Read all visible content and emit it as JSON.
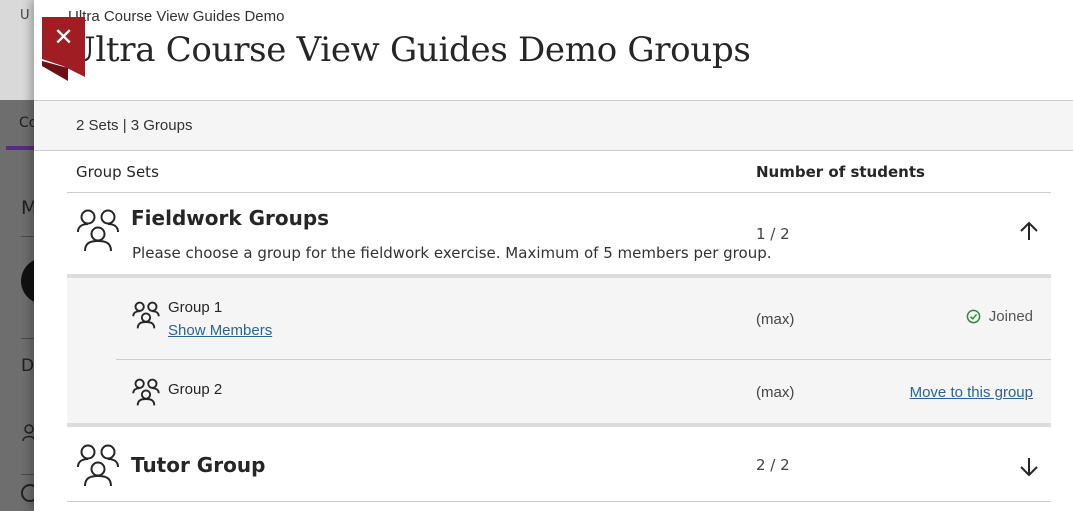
{
  "background": {
    "partial_letters": [
      "U",
      "Co",
      "M",
      "D"
    ]
  },
  "panel": {
    "close_label": "✕",
    "breadcrumb": "Ultra Course View Guides Demo",
    "title": "Ultra Course View Guides Demo Groups",
    "summary": "2 Sets | 3 Groups",
    "columns": {
      "group_sets": "Group Sets",
      "number_of_students": "Number of students"
    }
  },
  "group_sets": [
    {
      "name": "Fieldwork Groups",
      "description": "Please choose a group for the fieldwork exercise. Maximum of 5 members per group.",
      "count": "1 / 2",
      "expanded": true,
      "groups": [
        {
          "name": "Group 1",
          "show_members": "Show Members",
          "max": "(max)",
          "status": "Joined"
        },
        {
          "name": "Group 2",
          "max": "(max)",
          "action": "Move to this group"
        }
      ]
    },
    {
      "name": "Tutor Group",
      "count": "2 / 2",
      "expanded": false
    }
  ],
  "colors": {
    "close_red": "#a01e23",
    "link_blue": "#2a6496",
    "joined_green": "#2e8b3a",
    "tab_purple": "#5b2a86"
  },
  "icons": {
    "close": "close-icon",
    "group_set": "group-icon",
    "group": "group-small-icon",
    "collapse": "arrow-up-icon",
    "expand": "arrow-down-icon",
    "joined": "check-circle-icon"
  }
}
